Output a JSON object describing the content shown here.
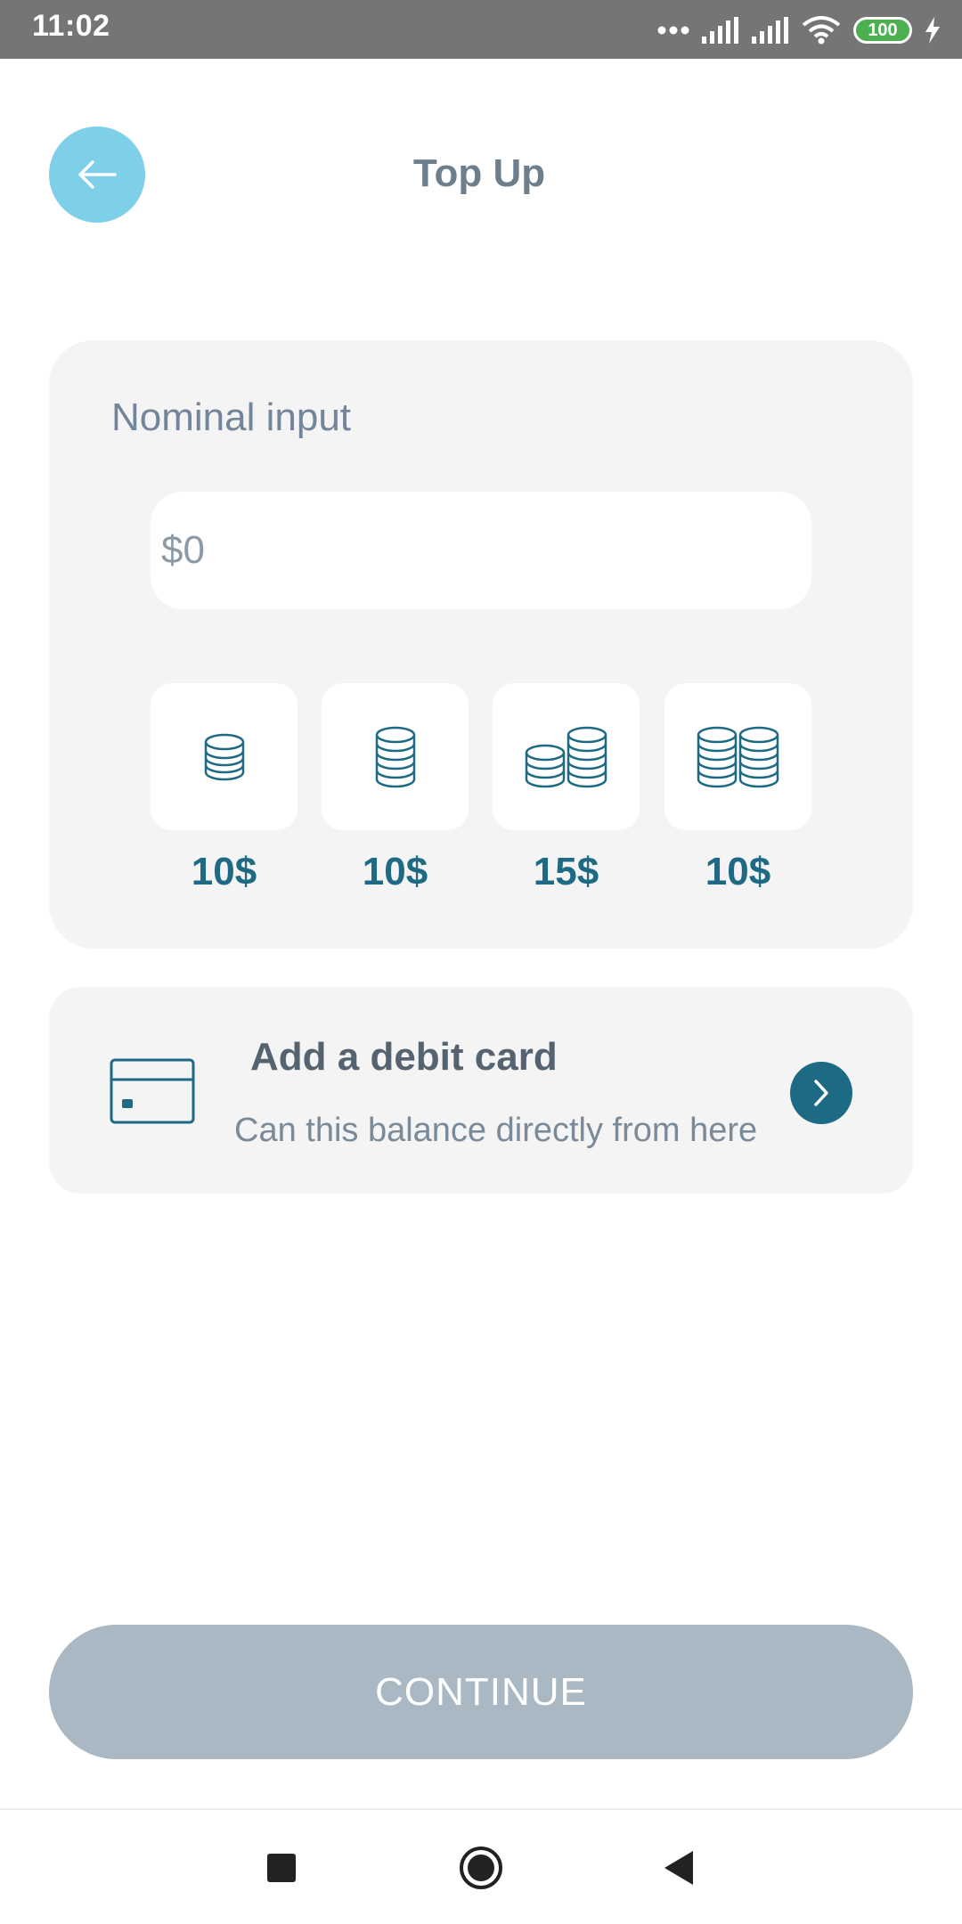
{
  "status_bar": {
    "time": "11:02",
    "battery": "100",
    "icons": [
      "dots-icon",
      "signal-icon",
      "signal-icon",
      "wifi-icon",
      "battery-icon",
      "charging-icon"
    ]
  },
  "header": {
    "title": "Top Up",
    "back_icon": "arrow-left-icon",
    "accent_color": "#7ecfe8"
  },
  "nominal": {
    "label": "Nominal input",
    "input_placeholder": "$0",
    "input_value": "",
    "options": [
      {
        "label": "10$",
        "icon": "coin-stack-small-icon"
      },
      {
        "label": "10$",
        "icon": "coin-stack-tall-icon"
      },
      {
        "label": "15$",
        "icon": "coin-stacks-double-icon"
      },
      {
        "label": "10$",
        "icon": "coin-stacks-large-icon"
      }
    ],
    "option_color": "#1e6a85"
  },
  "debit_card": {
    "title": "Add a debit card",
    "subtitle": "Can this balance directly from here",
    "icon": "credit-card-icon",
    "action_icon": "chevron-right-icon"
  },
  "continue_button": {
    "label": "CONTINUE",
    "color": "#a9b8c2"
  },
  "nav_bar": {
    "icons": [
      "recent-apps-icon",
      "home-icon",
      "back-triangle-icon"
    ]
  }
}
